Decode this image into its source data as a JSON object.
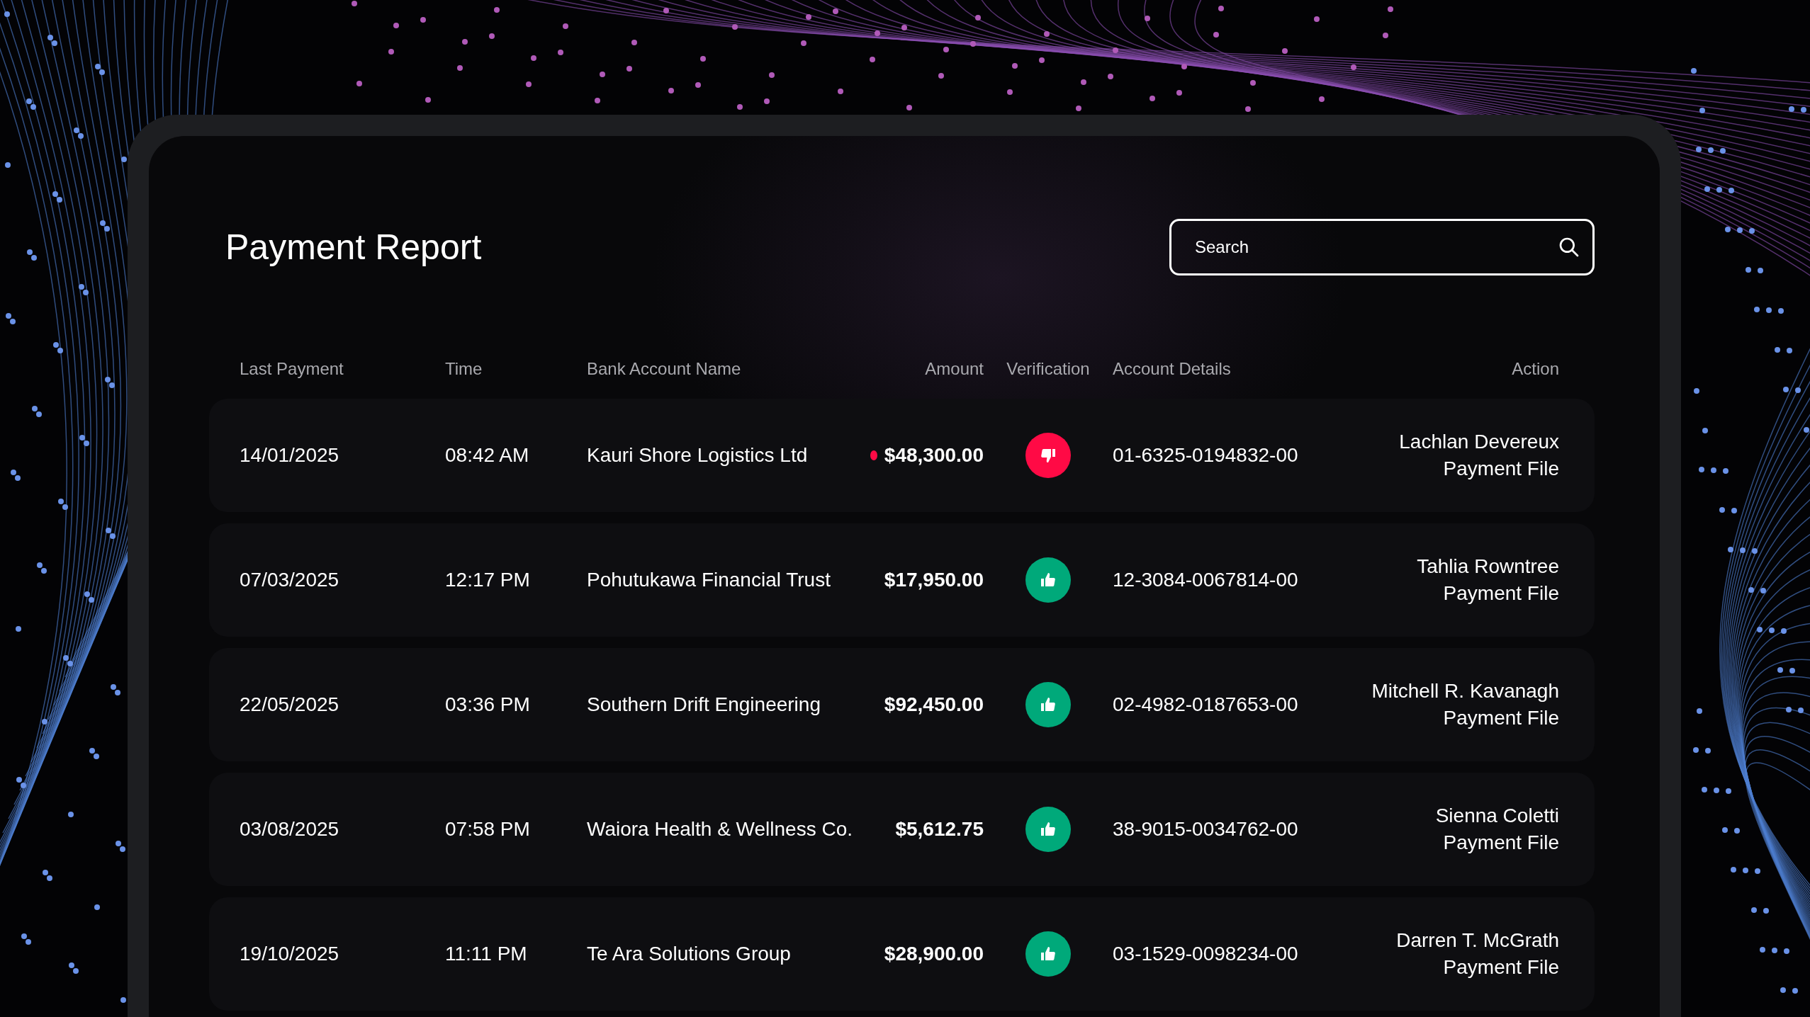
{
  "title": "Payment Report",
  "search": {
    "placeholder": "Search"
  },
  "columns": [
    "Last Payment",
    "Time",
    "Bank Account Name",
    "Amount",
    "Verification",
    "Account Details",
    "Action"
  ],
  "rows": [
    {
      "date": "14/01/2025",
      "time": "08:42 AM",
      "bank": "Kauri Shore Logistics Ltd",
      "amount": "$48,300.00",
      "verified": false,
      "account": "01-6325-0194832-00",
      "person": "Lachlan Devereux",
      "action": "Payment File"
    },
    {
      "date": "07/03/2025",
      "time": "12:17 PM",
      "bank": "Pohutukawa Financial Trust",
      "amount": "$17,950.00",
      "verified": true,
      "account": "12-3084-0067814-00",
      "person": "Tahlia Rowntree",
      "action": "Payment File"
    },
    {
      "date": "22/05/2025",
      "time": "03:36 PM",
      "bank": "Southern Drift Engineering",
      "amount": "$92,450.00",
      "verified": true,
      "account": "02-4982-0187653-00",
      "person": "Mitchell R. Kavanagh",
      "action": "Payment File"
    },
    {
      "date": "03/08/2025",
      "time": "07:58 PM",
      "bank": "Waiora Health & Wellness Co.",
      "amount": "$5,612.75",
      "verified": true,
      "account": "38-9015-0034762-00",
      "person": "Sienna Coletti",
      "action": "Payment File"
    },
    {
      "date": "19/10/2025",
      "time": "11:11 PM",
      "bank": "Te Ara Solutions Group",
      "amount": "$28,900.00",
      "verified": true,
      "account": "03-1529-0098234-00",
      "person": "Darren T. McGrath",
      "action": "Payment File"
    }
  ]
}
